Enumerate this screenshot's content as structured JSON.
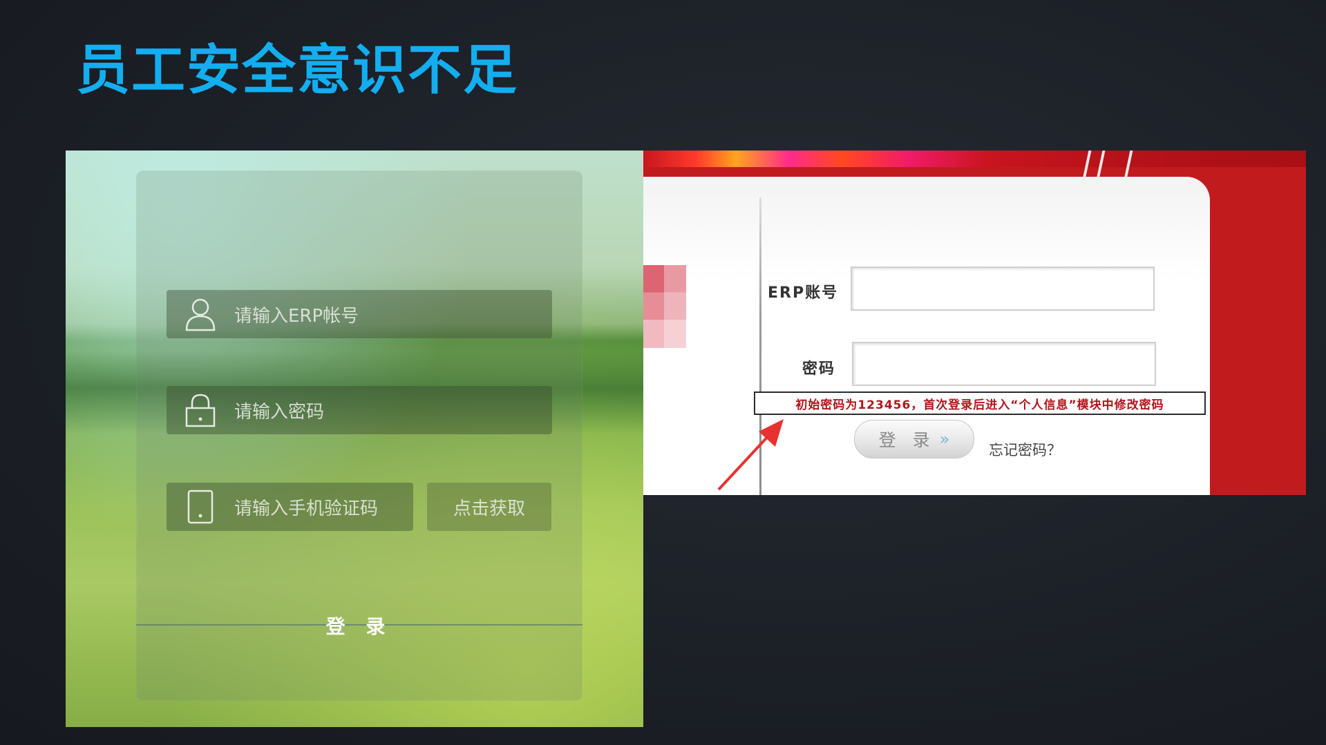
{
  "slide": {
    "title": "员工安全意识不足"
  },
  "left_login": {
    "account_placeholder": "请输入ERP帐号",
    "password_placeholder": "请输入密码",
    "sms_placeholder": "请输入手机验证码",
    "sms_button_label": "点击获取",
    "login_label": "登 录",
    "icons": [
      "user-icon",
      "lock-icon",
      "phone-icon"
    ]
  },
  "erp_login": {
    "account_label": "ERP账号",
    "password_label": "密码",
    "notice_text": "初始密码为123456，首次登录后进入“个人信息”模块中修改密码",
    "login_label": "登 录",
    "forgot_label": "忘记密码？",
    "colors": {
      "header_red": "#c21b1e",
      "notice_text": "#b2141b",
      "arrow": "#e8322f"
    }
  }
}
